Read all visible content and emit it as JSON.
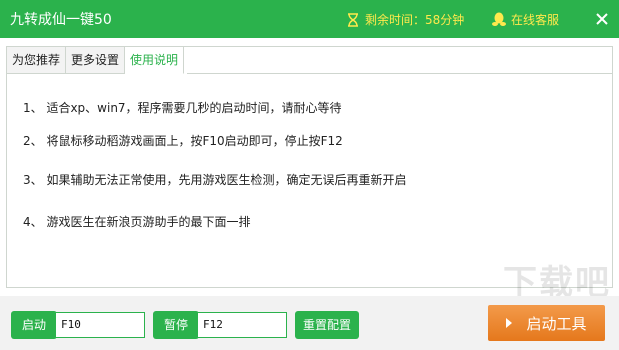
{
  "window": {
    "title": "九转成仙一键50",
    "timer_text": "剩余时间：58分钟",
    "service_text": "在线客服",
    "accent_color": "#2bb24c",
    "highlight_color": "#ffe94d"
  },
  "tabs": [
    {
      "label": "为您推荐",
      "active": false
    },
    {
      "label": "更多设置",
      "active": false
    },
    {
      "label": "使用说明",
      "active": true
    }
  ],
  "instructions": [
    "1、 适合xp、win7，程序需要几秒的启动时间，请耐心等待",
    "2、 将鼠标移动稻游戏画面上，按F10启动即可，停止按F12",
    "3、 如果辅助无法正常使用，先用游戏医生检测，确定无误后再重新开启",
    "4、 游戏医生在新浪页游助手的最下面一排"
  ],
  "bottom": {
    "start_label": "启动",
    "start_key": "F10",
    "pause_label": "暂停",
    "pause_key": "F12",
    "reset_label": "重置配置",
    "launch_label": "启动工具",
    "launch_color": "#e5781c"
  }
}
